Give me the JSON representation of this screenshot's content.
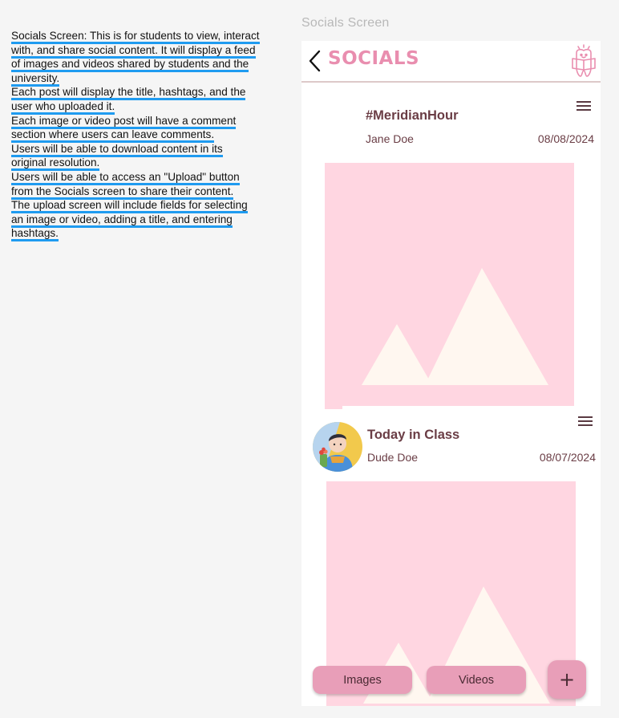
{
  "notes": [
    "Socials Screen: This is for students to view, interact with, and share social content. It will display a feed of images and videos shared by students and the university.",
    "Each post will display the title, hashtags, and the user who uploaded it.",
    "Each image or video post will have a comment section where users can leave comments.",
    "Users will be able to download content in its original resolution.",
    "Users will be able to access an \"Upload\" button from the Socials screen to share their content.",
    "The upload screen will include fields for selecting an image or video, adding a title, and entering hashtags."
  ],
  "frame_label": "Socials Screen",
  "header": {
    "title": "SOCIALS",
    "back_icon": "chevron-left-icon",
    "logo_icon": "reading-tooth-logo-icon"
  },
  "posts": [
    {
      "title": "#MeridianHour",
      "user": "Jane Doe",
      "date": "08/08/2024",
      "has_avatar": false,
      "menu_icon": "hamburger-menu-icon",
      "media_icon": "image-placeholder-icon"
    },
    {
      "title": "Today in Class",
      "user": "Dude Doe",
      "date": "08/07/2024",
      "has_avatar": true,
      "menu_icon": "hamburger-menu-icon",
      "media_icon": "image-placeholder-icon"
    }
  ],
  "bottom_bar": {
    "images_label": "Images",
    "videos_label": "Videos",
    "add_label": "+"
  },
  "colors": {
    "accent": "#e98eaf",
    "button": "#e89eb8",
    "placeholder_bg": "#ffd6e1",
    "placeholder_shape": "#fff7f0",
    "text_dark": "#6a3d45",
    "note_underline": "#1f9bf0"
  }
}
